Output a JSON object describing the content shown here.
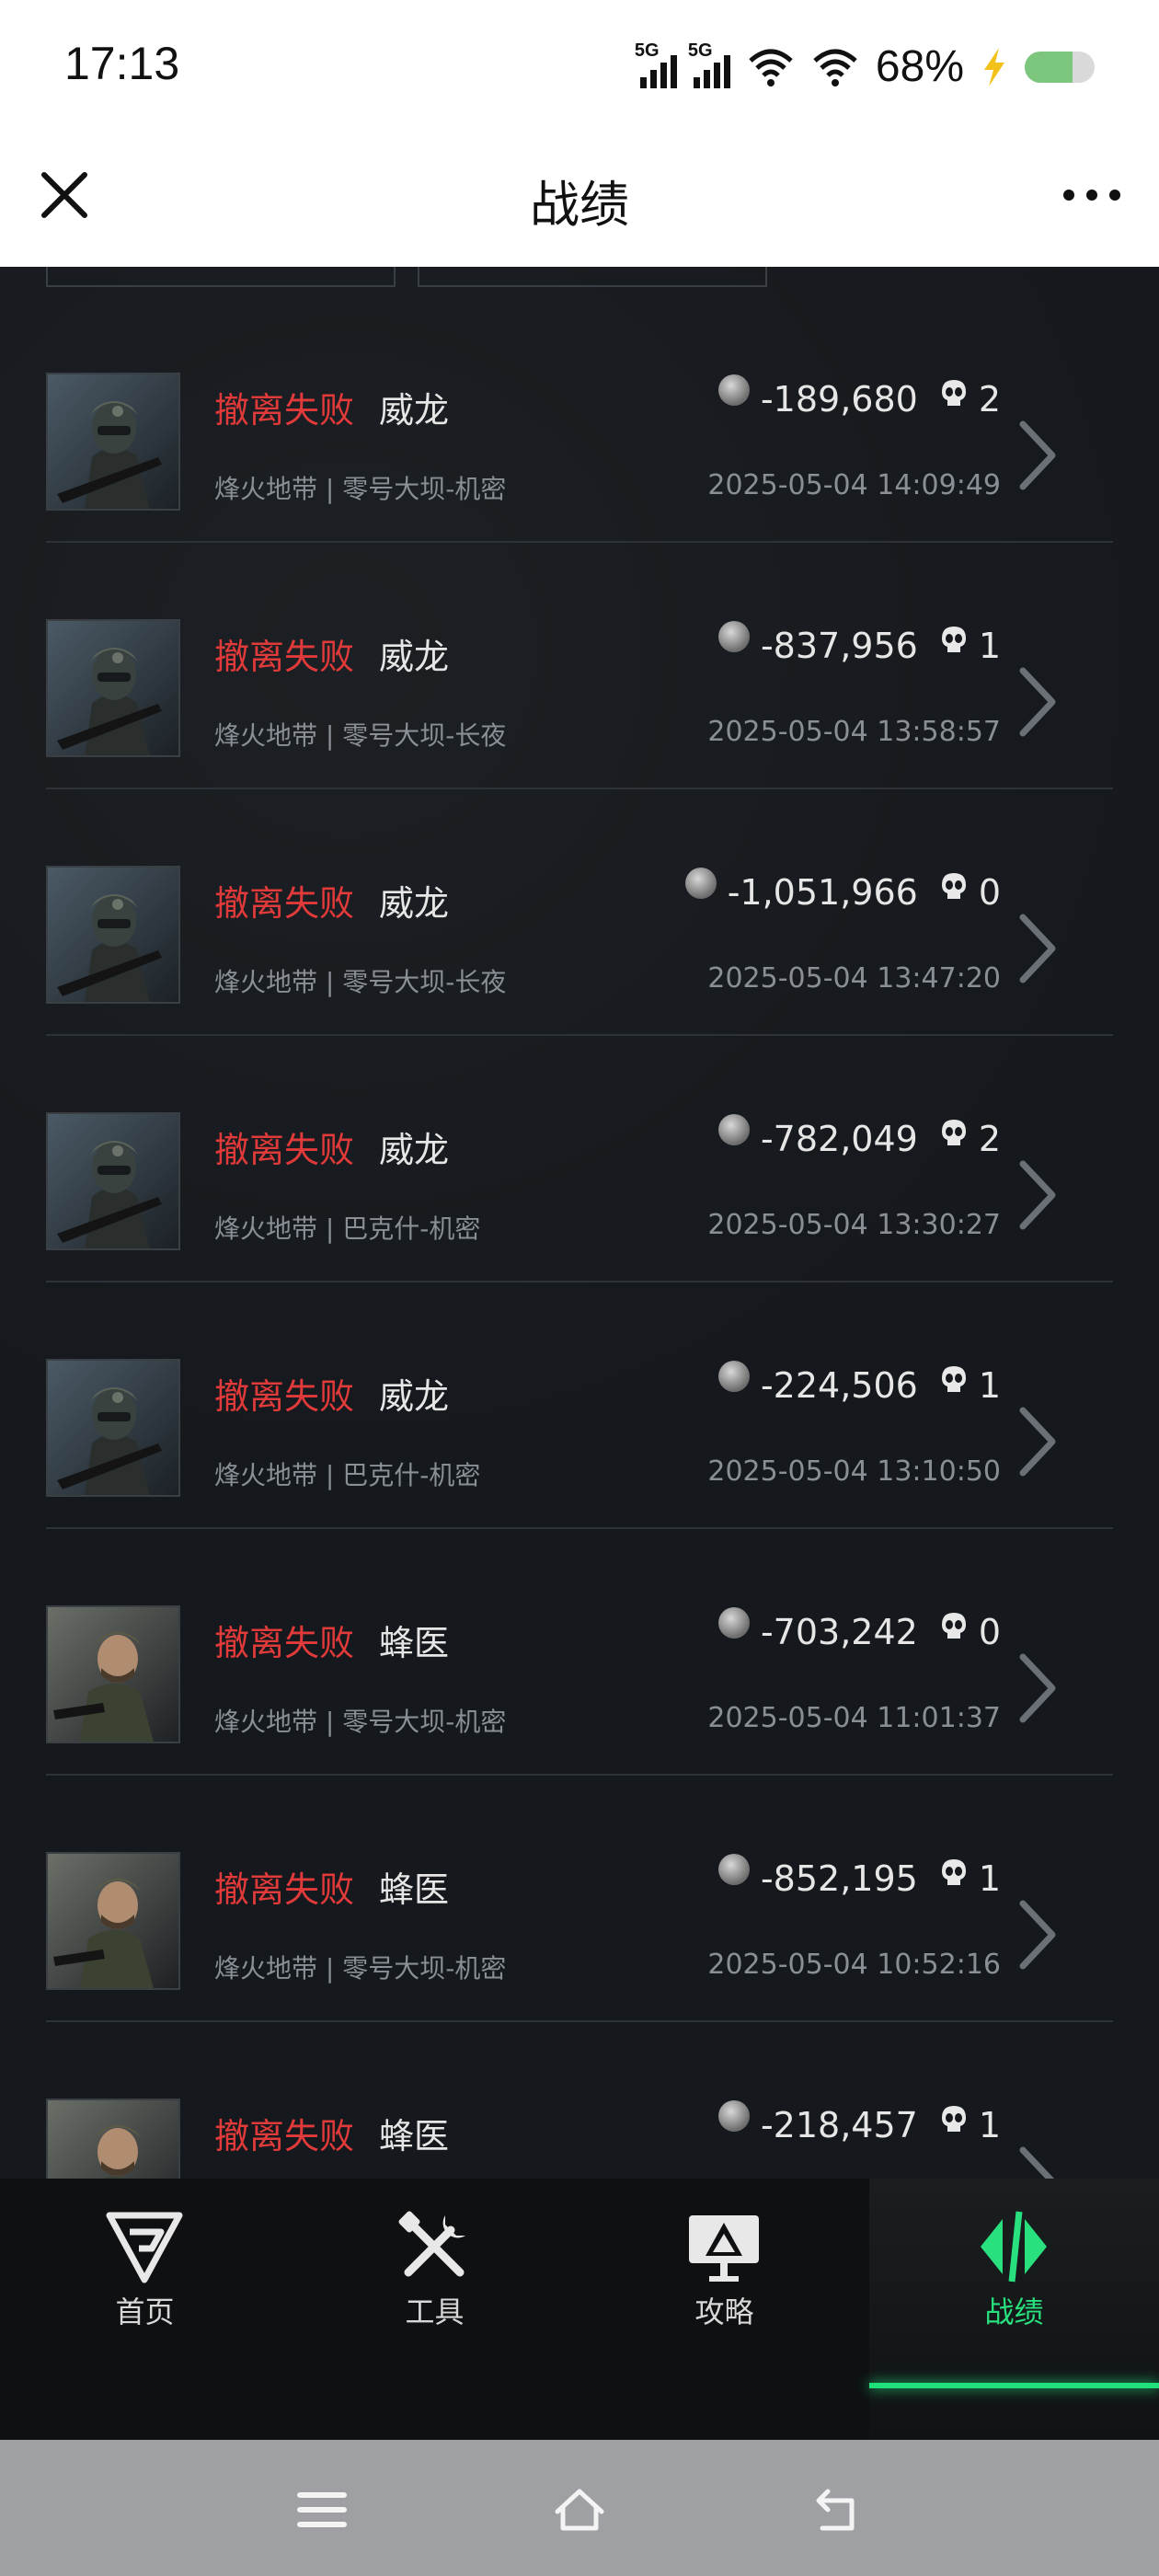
{
  "status_bar": {
    "time": "17:13",
    "sim1": "5G",
    "sim2": "5G",
    "battery_pct": "68%",
    "battery_level": 0.68
  },
  "header": {
    "title": "战绩"
  },
  "records": [
    {
      "status": "撤离失败",
      "operator": "威龙",
      "map": "烽火地带 | 零号大坝-机密",
      "value": "-189,680",
      "kills": "2",
      "time": "2025-05-04 14:09:49",
      "portrait": "weilong"
    },
    {
      "status": "撤离失败",
      "operator": "威龙",
      "map": "烽火地带 | 零号大坝-长夜",
      "value": "-837,956",
      "kills": "1",
      "time": "2025-05-04 13:58:57",
      "portrait": "weilong"
    },
    {
      "status": "撤离失败",
      "operator": "威龙",
      "map": "烽火地带 | 零号大坝-长夜",
      "value": "-1,051,966",
      "kills": "0",
      "time": "2025-05-04 13:47:20",
      "portrait": "weilong"
    },
    {
      "status": "撤离失败",
      "operator": "威龙",
      "map": "烽火地带 | 巴克什-机密",
      "value": "-782,049",
      "kills": "2",
      "time": "2025-05-04 13:30:27",
      "portrait": "weilong"
    },
    {
      "status": "撤离失败",
      "operator": "威龙",
      "map": "烽火地带 | 巴克什-机密",
      "value": "-224,506",
      "kills": "1",
      "time": "2025-05-04 13:10:50",
      "portrait": "weilong"
    },
    {
      "status": "撤离失败",
      "operator": "蜂医",
      "map": "烽火地带 | 零号大坝-机密",
      "value": "-703,242",
      "kills": "0",
      "time": "2025-05-04 11:01:37",
      "portrait": "fengyi"
    },
    {
      "status": "撤离失败",
      "operator": "蜂医",
      "map": "烽火地带 | 零号大坝-机密",
      "value": "-852,195",
      "kills": "1",
      "time": "2025-05-04 10:52:16",
      "portrait": "fengyi"
    },
    {
      "status": "撤离失败",
      "operator": "蜂医",
      "map": "",
      "value": "-218,457",
      "kills": "1",
      "time": "",
      "portrait": "fengyi"
    }
  ],
  "tabs": [
    {
      "label": "首页",
      "icon": "home-logo-icon"
    },
    {
      "label": "工具",
      "icon": "tools-icon"
    },
    {
      "label": "攻略",
      "icon": "guide-monitor-icon"
    },
    {
      "label": "战绩",
      "icon": "record-icon",
      "active": true
    }
  ],
  "colors": {
    "accent": "#1fe07a",
    "fail": "#e03a3a",
    "background": "#15181c"
  }
}
